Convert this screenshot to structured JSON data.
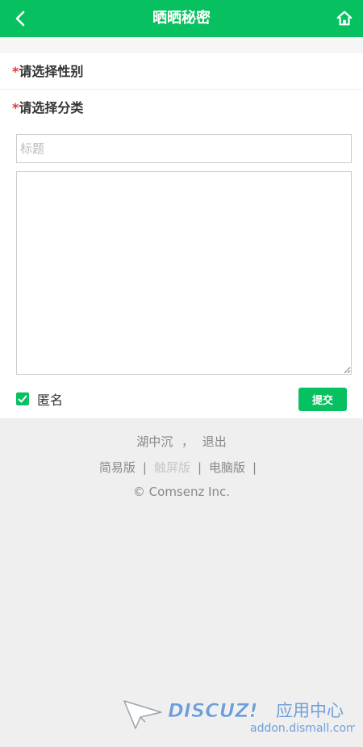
{
  "header": {
    "title": "晒晒秘密",
    "back_icon": "chevron-left-icon",
    "home_icon": "home-icon",
    "bg_color": "#07c160"
  },
  "form": {
    "gender_required_mark": "*",
    "gender_label": "请选择性别",
    "category_required_mark": "*",
    "category_label": "请选择分类",
    "title_placeholder": "标题",
    "content_value": "",
    "anonymous_checked": true,
    "anonymous_label": "匿名",
    "submit_label": "提交"
  },
  "footer": {
    "username": "湖中沉",
    "user_sep": "，",
    "logout": "退出",
    "link_simple": "简易版",
    "link_touch": "触屏版",
    "link_pc": "电脑版",
    "link_sep": "|",
    "copyright": "© Comsenz Inc."
  },
  "watermark": {
    "brand": "DISCUZ!",
    "brand_cn": "应用中心",
    "url": "addon.dismall.com"
  }
}
